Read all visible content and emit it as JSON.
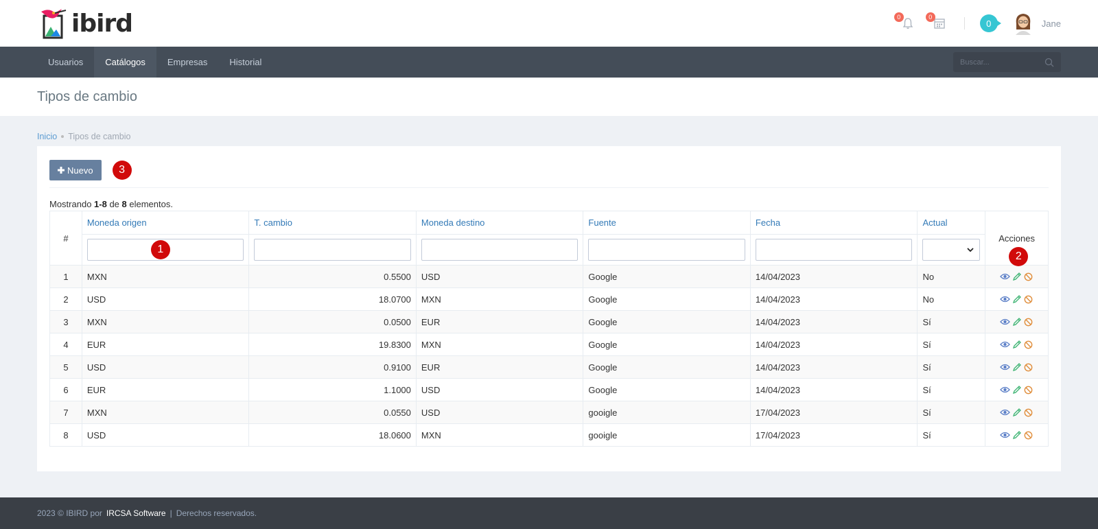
{
  "header": {
    "logo_text": "ibird",
    "notifications_count": "0",
    "calendar_count": "0",
    "inbox_count": "0",
    "user_name": "Jane"
  },
  "nav": {
    "items": [
      {
        "label": "Usuarios",
        "active": false
      },
      {
        "label": "Catálogos",
        "active": true
      },
      {
        "label": "Empresas",
        "active": false
      },
      {
        "label": "Historial",
        "active": false
      }
    ],
    "search_placeholder": "Buscar..."
  },
  "page": {
    "title": "Tipos de cambio",
    "breadcrumb": {
      "home": "Inicio",
      "current": "Tipos de cambio"
    }
  },
  "toolbar": {
    "new_label": "Nuevo",
    "marker_new": "3"
  },
  "summary": {
    "prefix": "Mostrando ",
    "range": "1-8",
    "mid": " de ",
    "total": "8",
    "suffix": " elementos."
  },
  "table": {
    "headers": {
      "num": "#",
      "moneda_origen": "Moneda origen",
      "t_cambio": "T. cambio",
      "moneda_destino": "Moneda destino",
      "fuente": "Fuente",
      "fecha": "Fecha",
      "actual": "Actual",
      "acciones": "Acciones"
    },
    "marker_filter": "1",
    "marker_actions": "2",
    "rows": [
      {
        "n": "1",
        "origen": "MXN",
        "cambio": "0.5500",
        "destino": "USD",
        "fuente": "Google",
        "fecha": "14/04/2023",
        "actual": "No"
      },
      {
        "n": "2",
        "origen": "USD",
        "cambio": "18.0700",
        "destino": "MXN",
        "fuente": "Google",
        "fecha": "14/04/2023",
        "actual": "No"
      },
      {
        "n": "3",
        "origen": "MXN",
        "cambio": "0.0500",
        "destino": "EUR",
        "fuente": "Google",
        "fecha": "14/04/2023",
        "actual": "Sí"
      },
      {
        "n": "4",
        "origen": "EUR",
        "cambio": "19.8300",
        "destino": "MXN",
        "fuente": "Google",
        "fecha": "14/04/2023",
        "actual": "Sí"
      },
      {
        "n": "5",
        "origen": "USD",
        "cambio": "0.9100",
        "destino": "EUR",
        "fuente": "Google",
        "fecha": "14/04/2023",
        "actual": "Sí"
      },
      {
        "n": "6",
        "origen": "EUR",
        "cambio": "1.1000",
        "destino": "USD",
        "fuente": "Google",
        "fecha": "14/04/2023",
        "actual": "Sí"
      },
      {
        "n": "7",
        "origen": "MXN",
        "cambio": "0.0550",
        "destino": "USD",
        "fuente": "gooigle",
        "fecha": "17/04/2023",
        "actual": "Sí"
      },
      {
        "n": "8",
        "origen": "USD",
        "cambio": "18.0600",
        "destino": "MXN",
        "fuente": "gooigle",
        "fecha": "17/04/2023",
        "actual": "Sí"
      }
    ]
  },
  "footer": {
    "prefix": "2023 © IBIRD por",
    "brand": "IRCSA Software",
    "separator": "|",
    "rights": "Derechos reservados."
  },
  "colors": {
    "nav_bg": "#444d58",
    "link": "#337ab7",
    "button": "#67809f",
    "marker": "#d10a0a",
    "badge": "#f36a5a",
    "teal": "#36c6d3",
    "footer_bg": "#3a3f46"
  },
  "icons": {
    "row_actions": [
      "eye-icon",
      "pencil-icon",
      "ban-icon"
    ],
    "header": [
      "bell-icon",
      "calendar-icon"
    ],
    "search": "search-icon"
  }
}
